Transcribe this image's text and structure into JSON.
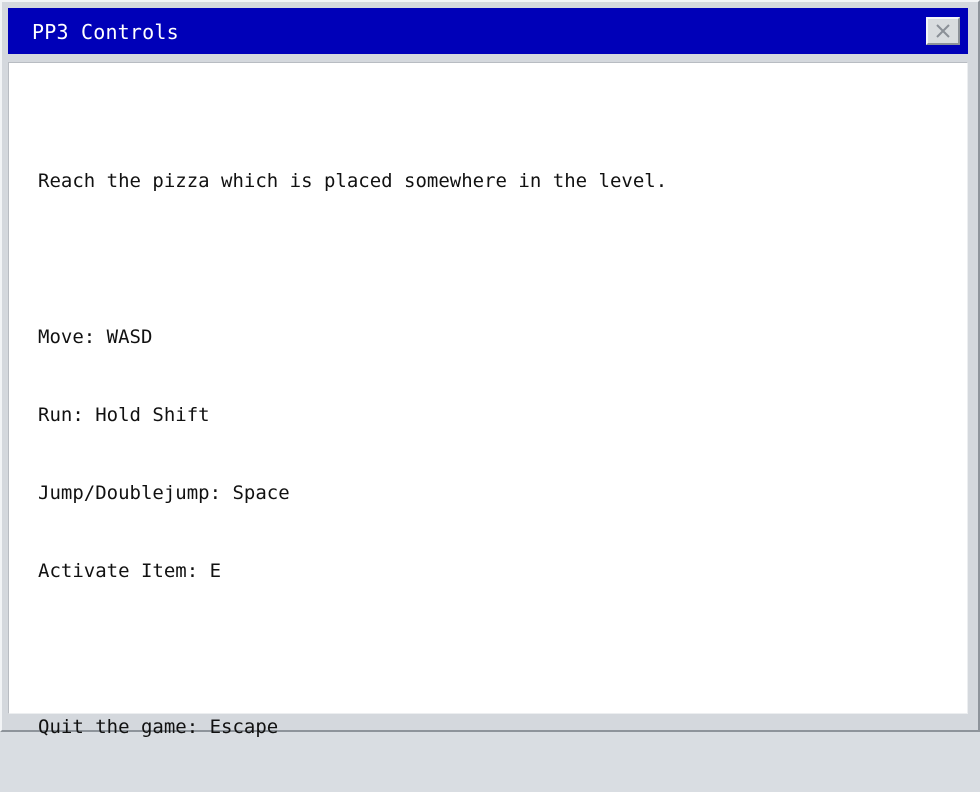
{
  "window": {
    "title": "PP3 Controls",
    "close_icon": "close-icon"
  },
  "instructions": {
    "goal": "Reach the pizza which is placed somewhere in the level.",
    "move": "Move: WASD",
    "run": "Run: Hold Shift",
    "jump": "Jump/Doublejump: Space",
    "activate": "Activate Item: E",
    "quit": "Quit the game: Escape"
  },
  "colors": {
    "titlebar": "#0000b8",
    "title_text": "#ffffff",
    "content_background": "#ffffff",
    "window_frame": "#d4d8dd"
  }
}
